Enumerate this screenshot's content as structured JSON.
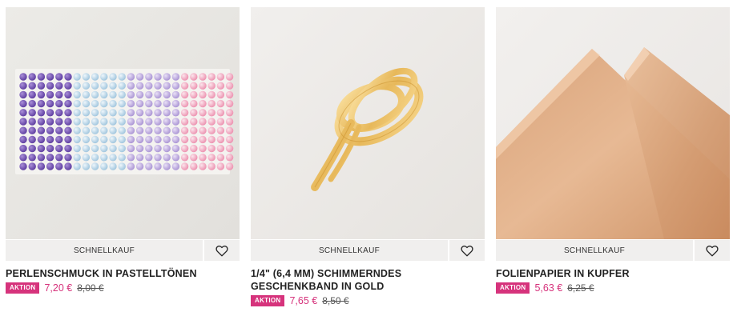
{
  "colors": {
    "accent": "#d6337c",
    "button_bg": "#f0efee"
  },
  "products": [
    {
      "quick_label": "SCHNELLKAUF",
      "favorite_icon": "heart-icon",
      "title": "PERLENSCHMUCK IN PASTELLTÖNEN",
      "badge": "AKTION",
      "price": "7,20 €",
      "old_price": "8,00 €"
    },
    {
      "quick_label": "SCHNELLKAUF",
      "favorite_icon": "heart-icon",
      "title_line1": "1/4\" (6,4 MM) SCHIMMERNDES",
      "title_line2": "GESCHENKBAND IN GOLD",
      "badge": "AKTION",
      "price": "7,65 €",
      "old_price": "8,50 €"
    },
    {
      "quick_label": "SCHNELLKAUF",
      "favorite_icon": "heart-icon",
      "title": "FOLIENPAPIER IN KUPFER",
      "badge": "AKTION",
      "price": "5,63 €",
      "old_price": "6,25 €"
    }
  ]
}
